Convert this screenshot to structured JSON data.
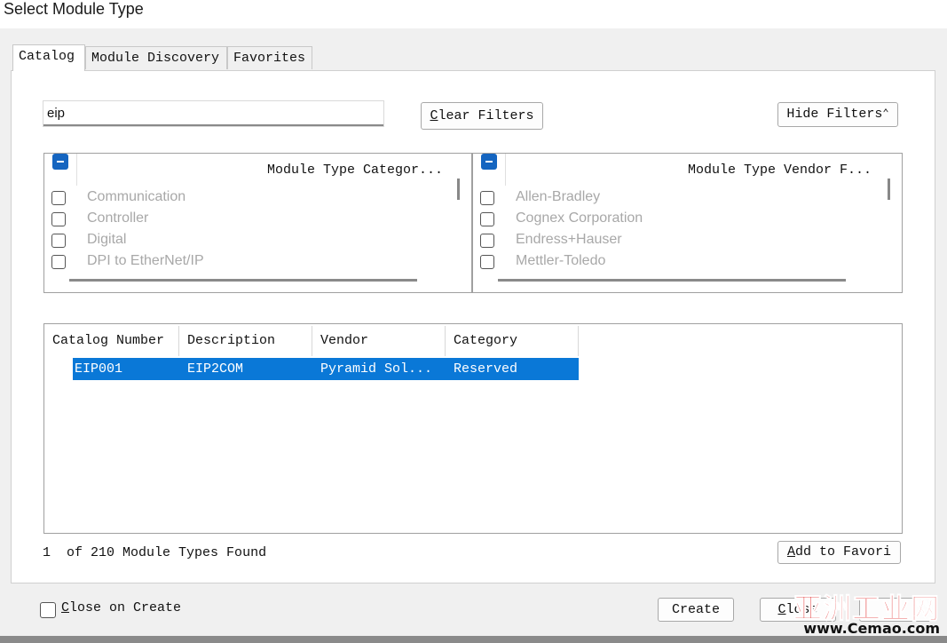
{
  "window": {
    "title": "Select Module Type"
  },
  "tabs": [
    {
      "label": "Catalog"
    },
    {
      "label": "Module Discovery"
    },
    {
      "label": "Favorites"
    }
  ],
  "search": {
    "value": "eip"
  },
  "buttons": {
    "clear_filters": "Clear Filters",
    "hide_filters": "Hide Filters",
    "add_to_favorites": "Add to Favori",
    "create": "Create",
    "close": "Close"
  },
  "category_filter": {
    "header": "Module Type Categor...",
    "items": [
      {
        "label": "Communication"
      },
      {
        "label": "Controller"
      },
      {
        "label": "Digital"
      },
      {
        "label": "DPI to EtherNet/IP"
      }
    ]
  },
  "vendor_filter": {
    "header": "Module Type Vendor F...",
    "items": [
      {
        "label": "Allen-Bradley"
      },
      {
        "label": "Cognex Corporation"
      },
      {
        "label": "Endress+Hauser"
      },
      {
        "label": "Mettler-Toledo"
      }
    ]
  },
  "results": {
    "columns": [
      "Catalog Number",
      "Description",
      "Vendor",
      "Category"
    ],
    "rows": [
      {
        "catalog_number": "EIP001",
        "description": "EIP2COM",
        "vendor": "Pyramid Sol...",
        "category": "Reserved"
      }
    ]
  },
  "status": {
    "count": "1",
    "text": "of 210 Module Types Found"
  },
  "close_on_create": {
    "label": "Close on Create",
    "checked": false
  },
  "watermark": {
    "cn": "亚洲工业网",
    "url": "www.Cemao.com"
  },
  "colors": {
    "accent": "#1565c0",
    "selection": "#0a78d7"
  },
  "icons": {
    "hide_filters": "double-chevron-up-icon",
    "filter_header": "minus-icon"
  }
}
